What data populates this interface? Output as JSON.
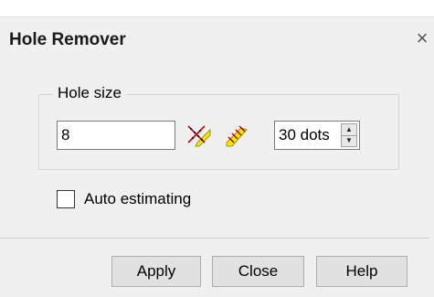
{
  "dialog": {
    "title": "Hole Remover",
    "close_glyph": "×"
  },
  "hole_size": {
    "group_label": "Hole size",
    "value": "8",
    "tool_icons": [
      "hole-remove-dots-icon",
      "hole-remove-lines-icon"
    ],
    "dots_value": "30 dots",
    "spin_up_glyph": "▲",
    "spin_down_glyph": "▼"
  },
  "auto_estimating": {
    "label": "Auto estimating",
    "checked": false
  },
  "buttons": {
    "apply": "Apply",
    "close": "Close",
    "help": "Help"
  }
}
